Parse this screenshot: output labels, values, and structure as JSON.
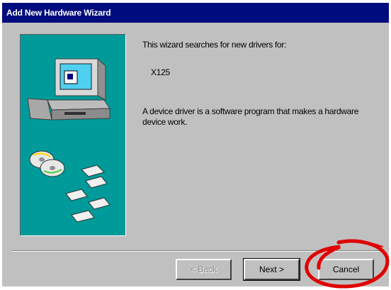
{
  "window": {
    "title": "Add New Hardware Wizard"
  },
  "content": {
    "intro": "This wizard searches for new drivers for:",
    "device_name": "X125",
    "description": "A device driver is a software program that makes a hardware device work."
  },
  "buttons": {
    "back": "< Back",
    "next": "Next >",
    "cancel": "Cancel"
  },
  "colors": {
    "titlebar": "#000c7e",
    "panel": "#009a9a",
    "face": "#c0c0c0",
    "annotation": "#e00000"
  },
  "icons": {
    "illustration": "computer-with-discs-and-floppies-illustration",
    "annotation": "red-hand-drawn-circle"
  }
}
